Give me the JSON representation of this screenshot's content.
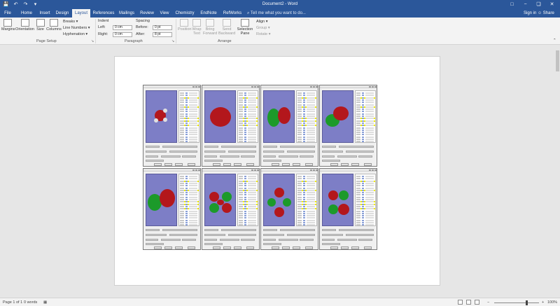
{
  "window": {
    "title": "Document2 - Word",
    "controls": [
      "□",
      "−",
      "❏",
      "✕"
    ]
  },
  "quick_access": {
    "save_glyph": "💾",
    "undo_glyph": "↶",
    "redo_glyph": "↷",
    "customize_glyph": "▾"
  },
  "tabs": [
    "File",
    "Home",
    "Insert",
    "Design",
    "Layout",
    "References",
    "Mailings",
    "Review",
    "View",
    "Chemistry",
    "EndNote X8",
    "RefWorks"
  ],
  "active_tab": "Layout",
  "tell_me": "⌕ Tell me what you want to do...",
  "account": {
    "sign_in": "Sign in",
    "share": "☺ Share"
  },
  "ribbon": {
    "page_setup": {
      "label": "Page Setup",
      "margins": "Margins",
      "orientation": "Orientation",
      "size": "Size",
      "columns": "Columns",
      "breaks": "Breaks ▾",
      "line_numbers": "Line Numbers ▾",
      "hyphenation": "Hyphenation ▾"
    },
    "paragraph": {
      "label": "Paragraph",
      "indent": "Indent",
      "spacing": "Spacing",
      "left_label": "Left:",
      "left_value": "0 cm",
      "right_label": "Right:",
      "right_value": "0 cm",
      "before_label": "Before:",
      "before_value": "0 pt",
      "after_label": "After:",
      "after_value": "8 pt"
    },
    "arrange": {
      "label": "Arrange",
      "position": "Position",
      "wrap_text": "Wrap Text",
      "bring_forward": "Bring Forward",
      "send_backward": "Send Backward",
      "selection_pane": "Selection Pane",
      "align": "Align ▾",
      "group": "Group ▾",
      "rotate": "Rotate ▾"
    }
  },
  "status_bar": {
    "page": "Page 1 of 1",
    "words": "0 words",
    "zoom": "100%"
  },
  "document": {
    "screenshots": [
      {
        "orbital": "lone-pair"
      },
      {
        "orbital": "s-type"
      },
      {
        "orbital": "p-type"
      },
      {
        "orbital": "p-type-tilted"
      },
      {
        "orbital": "p-type-large"
      },
      {
        "orbital": "d-type-4-lobe"
      },
      {
        "orbital": "d-type-cross"
      },
      {
        "orbital": "d-type-diagonal"
      }
    ]
  },
  "colors": {
    "title_bar": "#2b579a",
    "viewer_bg": "#7d7ec6",
    "lobe_red": "#b3171c",
    "lobe_green": "#1c9a2a",
    "highlight": "#f3f000"
  }
}
